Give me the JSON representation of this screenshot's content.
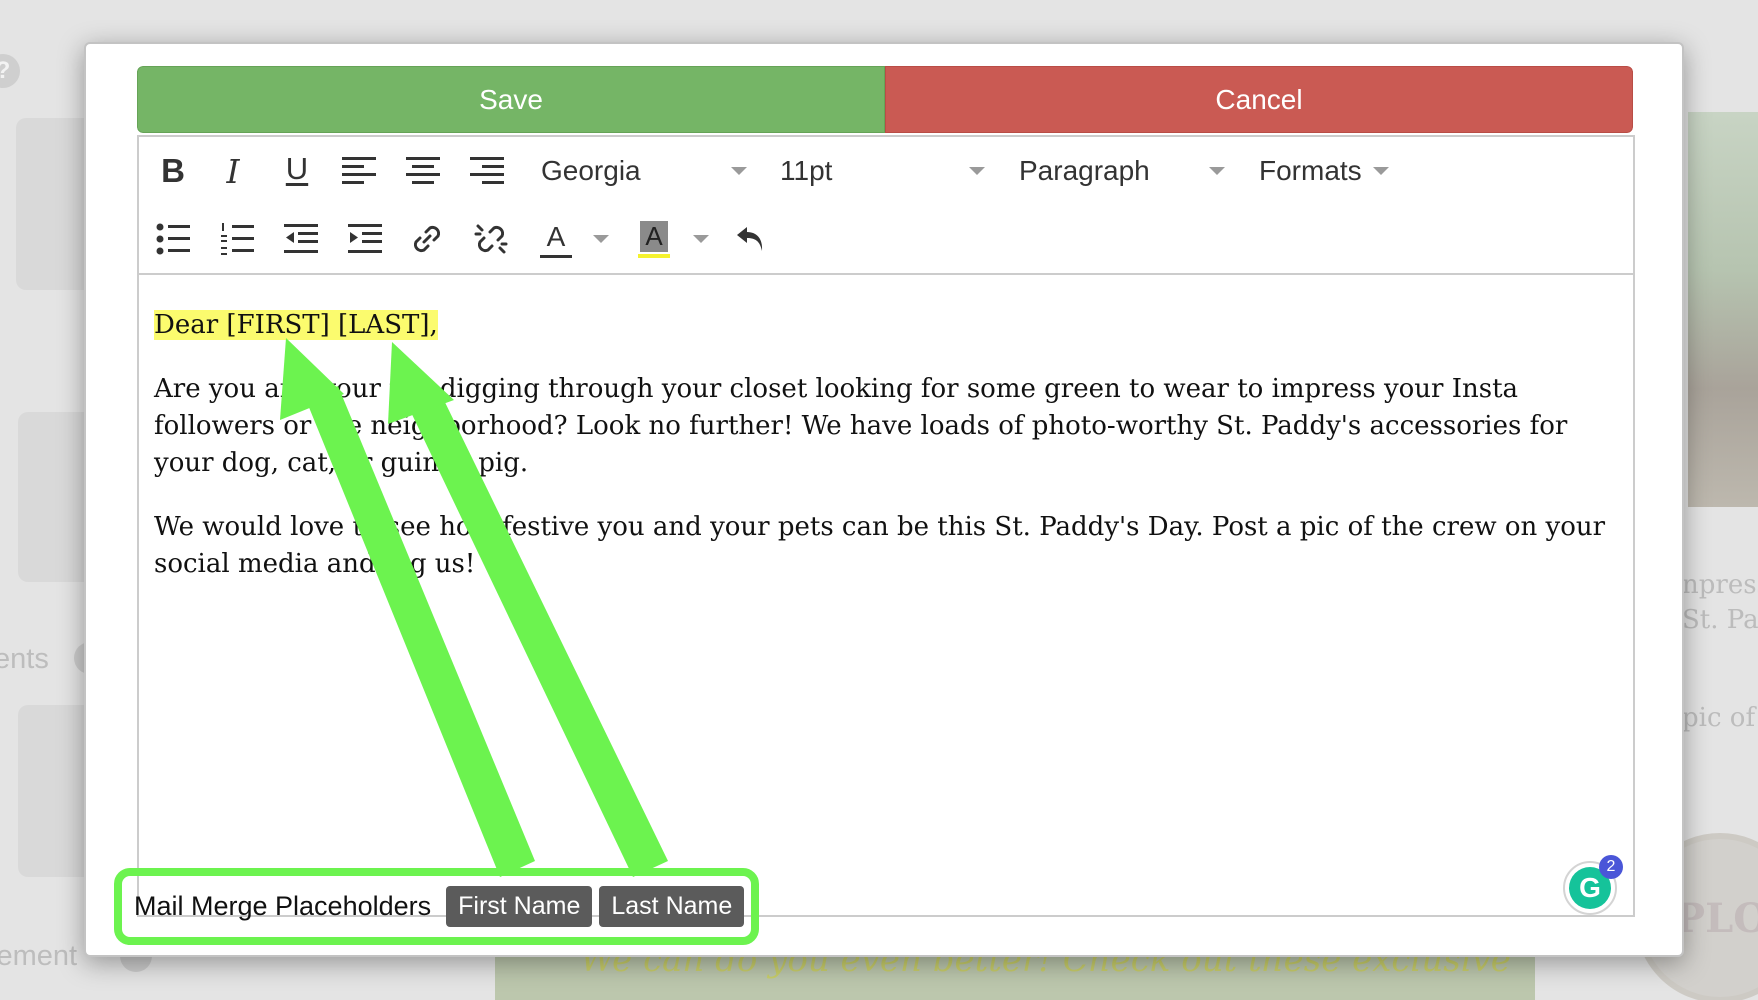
{
  "background": {
    "help_glyph": "?",
    "labels": [
      "ents",
      "lement"
    ],
    "right_text": [
      "npress",
      "St. Pa",
      "pic of"
    ],
    "logo_text": "PLO",
    "banner_text": "We can do you even better! Check out these exclusive"
  },
  "modal": {
    "save_label": "Save",
    "cancel_label": "Cancel",
    "toolbar": {
      "font_family": "Georgia",
      "font_size": "11pt",
      "block_format": "Paragraph",
      "formats_label": "Formats",
      "icons": [
        "bold-icon",
        "italic-icon",
        "underline-icon",
        "align-left-icon",
        "align-center-icon",
        "align-right-icon",
        "bullet-list-icon",
        "numbered-list-icon",
        "outdent-icon",
        "indent-icon",
        "link-icon",
        "unlink-icon",
        "text-color-icon",
        "background-color-icon",
        "undo-icon"
      ],
      "bold_glyph": "B",
      "italic_glyph": "I",
      "underline_glyph": "U",
      "text_color_glyph": "A",
      "bg_color_glyph": "A"
    },
    "content": {
      "greeting": "Dear [FIRST] [LAST],",
      "paragraphs": [
        "Are you and your pet digging through your closet looking for some green to wear to impress your Insta followers or the neighborhood? Look no further! We have loads of photo-worthy St. Paddy's accessories for your dog, cat, or guinea pig.",
        "We would love to see how festive you and your pets can be this St. Paddy's Day. Post a pic of the crew on your social media and tag us!"
      ]
    },
    "grammarly": {
      "glyph": "G",
      "count": "2"
    },
    "merge": {
      "label": "Mail Merge Placeholders",
      "chips": [
        "First Name",
        "Last Name"
      ]
    }
  },
  "colors": {
    "save": "#75b566",
    "cancel": "#ca5a53",
    "highlight": "#fbfb6e",
    "annotation": "#6cf34f",
    "chip": "#5b5b5b"
  }
}
